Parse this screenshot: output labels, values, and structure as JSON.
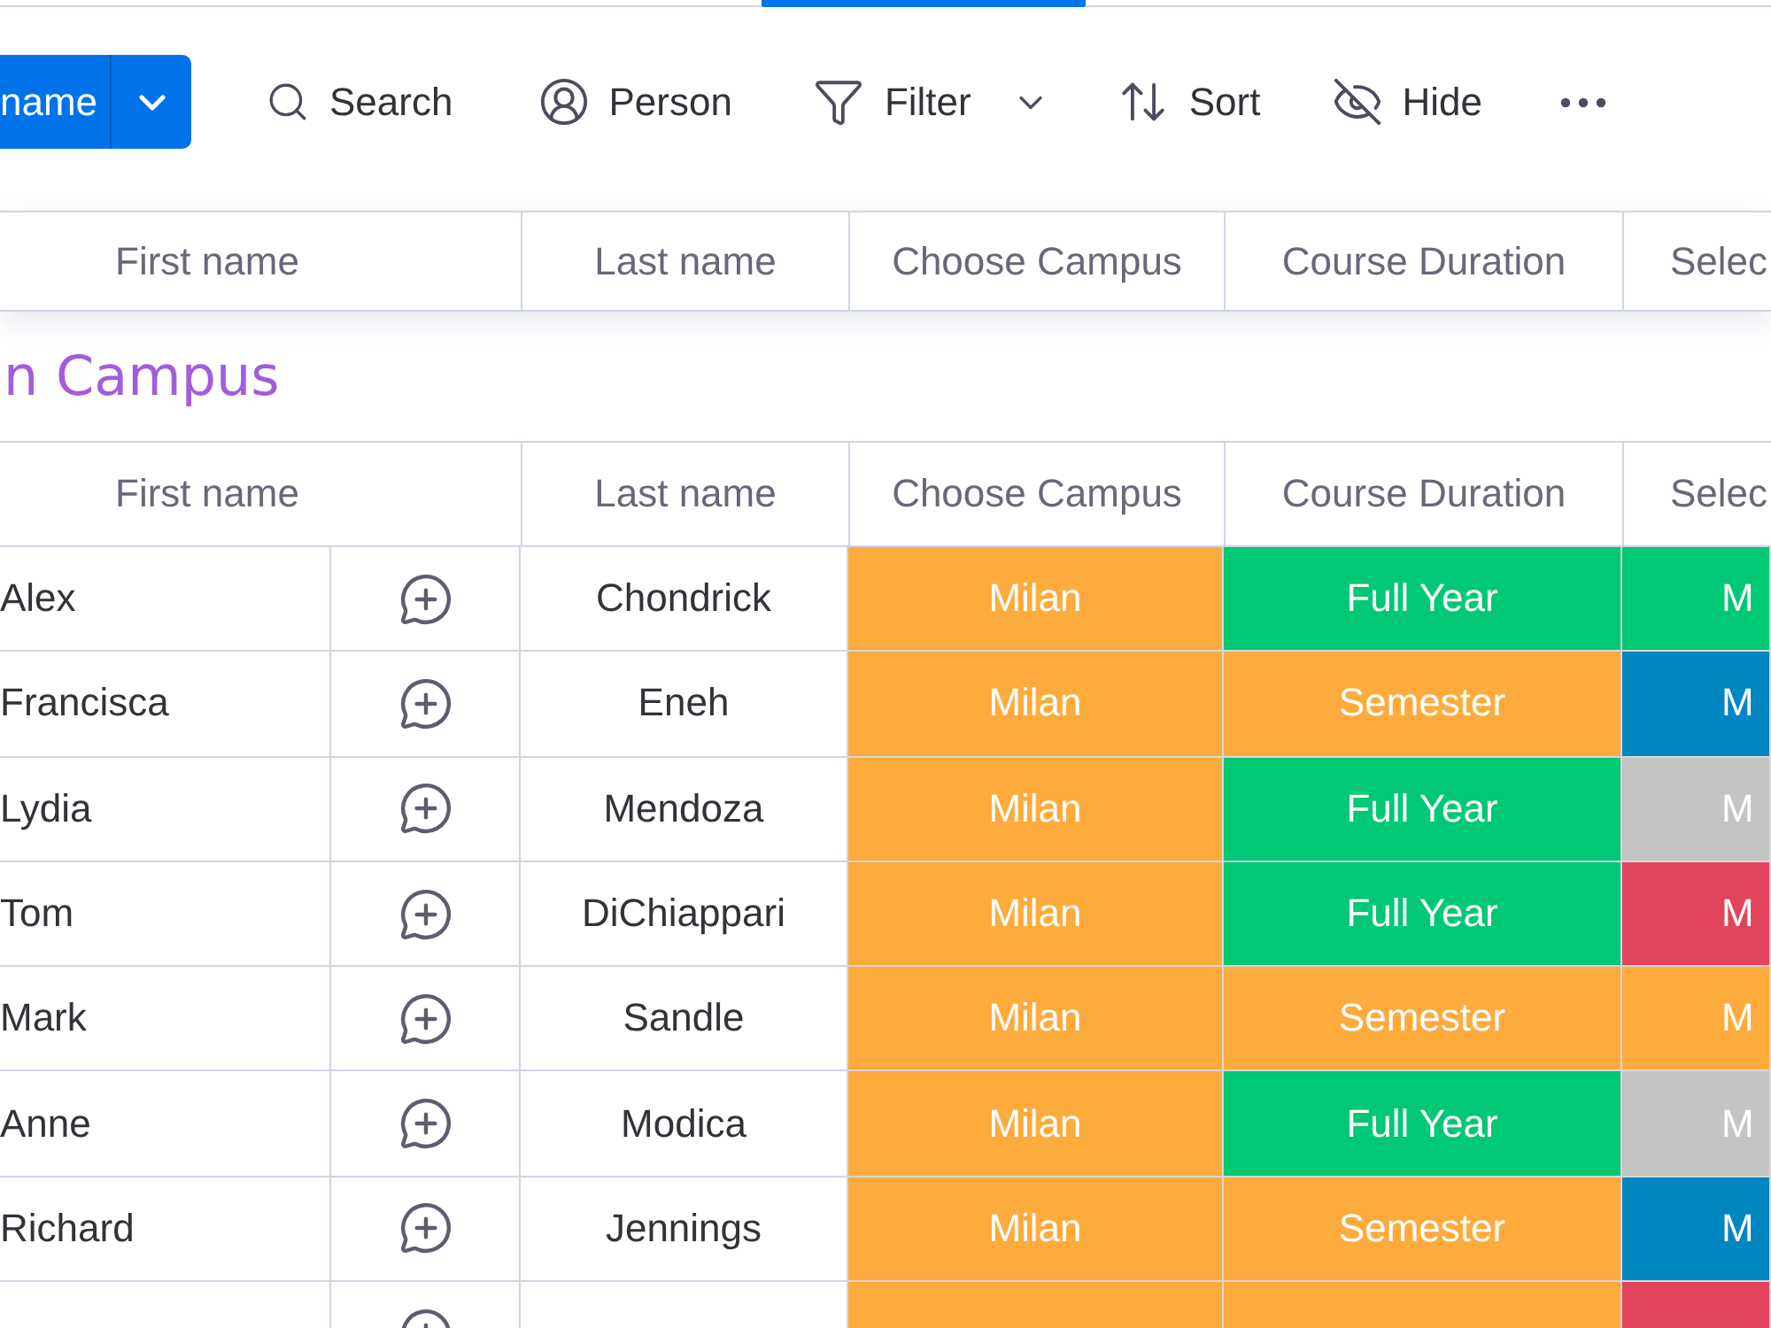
{
  "view_tabs": [
    {
      "selected": false
    },
    {
      "selected": true
    },
    {
      "selected": false
    }
  ],
  "toolbar": {
    "primary_button": {
      "label": "name"
    },
    "tools": [
      {
        "kind": "search",
        "label": "Search",
        "dropdown": false
      },
      {
        "kind": "person",
        "label": "Person",
        "dropdown": false
      },
      {
        "kind": "filter",
        "label": "Filter",
        "dropdown": true
      },
      {
        "kind": "sort",
        "label": "Sort",
        "dropdown": false
      },
      {
        "kind": "hide",
        "label": "Hide",
        "dropdown": false
      },
      {
        "kind": "more",
        "dropdown": false
      }
    ]
  },
  "sticky_header": {
    "columns": [
      "First name",
      "Last name",
      "Choose Campus",
      "Course Duration",
      "Selec"
    ]
  },
  "group": {
    "title": "n Campus",
    "columns": [
      "First name",
      "Last name",
      "Choose Campus",
      "Course Duration",
      "Selec"
    ],
    "rows": [
      {
        "first_name": "Alex",
        "last_name": "Chondrick",
        "campus": {
          "label": "Milan",
          "color": "#fdab3d"
        },
        "course_duration": {
          "label": "Full Year",
          "color": "#00c875"
        },
        "column_5": {
          "label": "M",
          "color": "#00c875"
        }
      },
      {
        "first_name": "Francisca",
        "last_name": "Eneh",
        "campus": {
          "label": "Milan",
          "color": "#fdab3d"
        },
        "course_duration": {
          "label": "Semester",
          "color": "#fdab3d"
        },
        "column_5": {
          "label": "M",
          "color": "#0086c0"
        }
      },
      {
        "first_name": "Lydia",
        "last_name": "Mendoza",
        "campus": {
          "label": "Milan",
          "color": "#fdab3d"
        },
        "course_duration": {
          "label": "Full Year",
          "color": "#00c875"
        },
        "column_5": {
          "label": "M",
          "color": "#c4c4c4"
        }
      },
      {
        "first_name": "Tom",
        "last_name": "DiChiappari",
        "campus": {
          "label": "Milan",
          "color": "#fdab3d"
        },
        "course_duration": {
          "label": "Full Year",
          "color": "#00c875"
        },
        "column_5": {
          "label": "M",
          "color": "#e2445c"
        }
      },
      {
        "first_name": "Mark",
        "last_name": "Sandle",
        "campus": {
          "label": "Milan",
          "color": "#fdab3d"
        },
        "course_duration": {
          "label": "Semester",
          "color": "#fdab3d"
        },
        "column_5": {
          "label": "M",
          "color": "#fdab3d"
        }
      },
      {
        "first_name": "Anne",
        "last_name": "Modica",
        "campus": {
          "label": "Milan",
          "color": "#fdab3d"
        },
        "course_duration": {
          "label": "Full Year",
          "color": "#00c875"
        },
        "column_5": {
          "label": "M",
          "color": "#c4c4c4"
        }
      },
      {
        "first_name": "Richard",
        "last_name": "Jennings",
        "campus": {
          "label": "Milan",
          "color": "#fdab3d"
        },
        "course_duration": {
          "label": "Semester",
          "color": "#fdab3d"
        },
        "column_5": {
          "label": "M",
          "color": "#0086c0"
        }
      },
      {
        "campus": {
          "color": "#fdab3d"
        },
        "course_duration": {
          "color": "#fdab3d"
        },
        "column_5": {
          "color": "#e2445c"
        }
      }
    ]
  }
}
